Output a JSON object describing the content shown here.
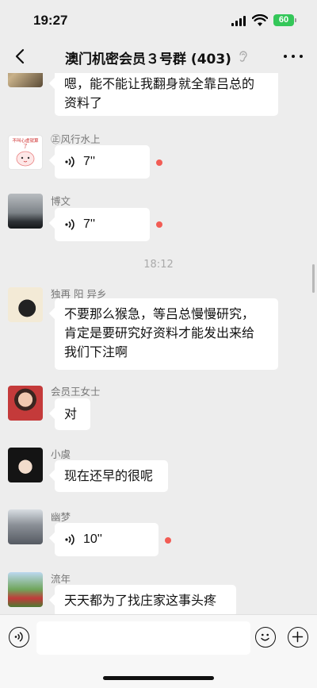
{
  "status_bar": {
    "time": "19:27",
    "battery": "60"
  },
  "header": {
    "title": "澳门机密会员３号群 (403)"
  },
  "messages": [
    {
      "sender": "",
      "type": "text",
      "text": "嗯，能不能让我翻身就全靠吕总的\n资料了"
    },
    {
      "sender": "㊣风行水上",
      "type": "voice",
      "duration": "7''",
      "avatar_caption": "不叫心虚就算了"
    },
    {
      "sender": "博文",
      "type": "voice",
      "duration": "7''"
    },
    {
      "sender": "独再 阳 异乡",
      "type": "text",
      "text": "不要那么猴急，等吕总慢慢研究，\n肯定是要研究好资料才能发出来给\n我们下注啊"
    },
    {
      "sender": "会员王女士",
      "type": "text",
      "text": "对"
    },
    {
      "sender": "小虞",
      "type": "text",
      "text": "现在还早的很呢"
    },
    {
      "sender": "幽梦",
      "type": "voice",
      "duration": "10''"
    },
    {
      "sender": "流年",
      "type": "text",
      "text": "天天都为了找庄家这事头疼"
    }
  ],
  "time_separator": "18:12",
  "colors": {
    "background": "#ededed",
    "bubble": "#ffffff",
    "unread_dot": "#f25c54",
    "battery": "#34c759"
  },
  "icons": {
    "back": "chevron-left-icon",
    "more": "more-dots-icon",
    "voice_input": "voice-input-icon",
    "emoji": "emoji-icon",
    "add": "plus-icon"
  }
}
